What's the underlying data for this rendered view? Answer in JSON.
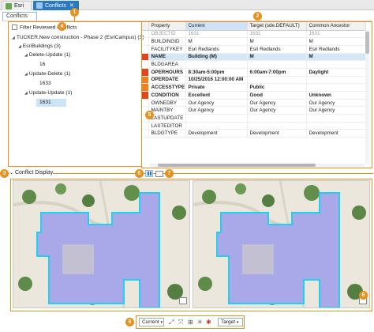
{
  "tabs": [
    {
      "label": "Esri"
    },
    {
      "label": "Conflicts"
    }
  ],
  "subtab": "Conflicts",
  "filter_label": "Filter Reviewed Conflicts",
  "tree": {
    "root": "TUCKER.New construction - Phase 2 (EsriCampus) (3)",
    "class": "EsriBuildings (3)",
    "group1": "Delete-Update (1)",
    "g1item": "16",
    "group2": "Update-Delete (1)",
    "g2item": "1633",
    "group3": "Update-Update (1)",
    "g3item": "1631"
  },
  "table": {
    "headers": [
      "Property",
      "Current",
      "Target (sde.DEFAULT)",
      "Common Ancestor"
    ],
    "rows": [
      {
        "p": "OBJECTID",
        "c": "1631",
        "t": "1631",
        "a": "1631",
        "dim": true,
        "mark": ""
      },
      {
        "p": "BUILDINGID",
        "c": "M",
        "t": "M",
        "a": "M",
        "dim": false,
        "mark": ""
      },
      {
        "p": "FACILITYKEY",
        "c": "Esri Redlands",
        "t": "Esri Redlands",
        "a": "Esri Redlands",
        "dim": false,
        "mark": ""
      },
      {
        "p": "NAME",
        "c": "Building (M)",
        "t": "M",
        "a": "M",
        "hl": true,
        "conf": true,
        "mark": "red"
      },
      {
        "p": "BLDGAREA",
        "c": "",
        "t": "",
        "a": "",
        "mark": ""
      },
      {
        "p": "OPERHOURS",
        "c": "8:30am-5:00pm",
        "t": "6:00am-7:00pm",
        "a": "Daylight",
        "conf": true,
        "mark": "red"
      },
      {
        "p": "OPERDATE",
        "c": "10/25/2016 12:00:00 AM",
        "t": "",
        "a": "",
        "conf": true,
        "mark": "org"
      },
      {
        "p": "ACCESSTYPE",
        "c": "Private",
        "t": "Public",
        "a": "",
        "conf": true,
        "mark": "org"
      },
      {
        "p": "CONDITION",
        "c": "Excellent",
        "t": "Good",
        "a": "Unknown",
        "conf": true,
        "mark": "red"
      },
      {
        "p": "OWNEDBY",
        "c": "Our Agency",
        "t": "Our Agency",
        "a": "Our Agency",
        "mark": ""
      },
      {
        "p": "MAINTBY",
        "c": "Our Agency",
        "t": "Our Agency",
        "a": "Our Agency",
        "mark": ""
      },
      {
        "p": "LASTUPDATE",
        "c": "",
        "t": "",
        "a": "",
        "mark": ""
      },
      {
        "p": "LASTEDITOR",
        "c": "",
        "t": "",
        "a": "",
        "mark": ""
      },
      {
        "p": "BLDGTYPE",
        "c": "Development",
        "t": "Development",
        "a": "Development",
        "mark": ""
      }
    ]
  },
  "conflict_display_label": "Conflict Display",
  "bottom": {
    "current": "Current",
    "target": "Target"
  },
  "markers": [
    "1",
    "2",
    "3",
    "4",
    "5",
    "6",
    "7",
    "8",
    "9"
  ],
  "colors": {
    "marker": "#e8901c",
    "accent": "#2b79c2",
    "footprint": "#a9a9ea",
    "outline": "#20d0f0"
  }
}
